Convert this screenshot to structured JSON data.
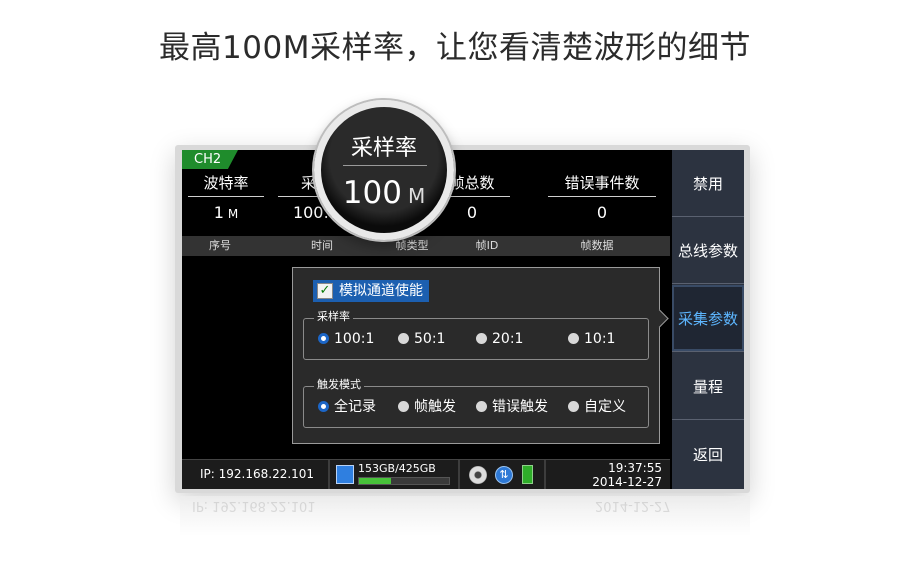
{
  "headline": "最高100M采样率，让您看清楚波形的细节",
  "channel_tag": "CH2",
  "stats": [
    {
      "label": "波特率",
      "value": "1",
      "unit": "M"
    },
    {
      "label": "采样",
      "value": "100:1",
      "unit": ""
    },
    {
      "label": "帧总数",
      "value": "0",
      "unit": ""
    },
    {
      "label": "错误事件数",
      "value": "0",
      "unit": ""
    }
  ],
  "table_headers": [
    "序号",
    "时间",
    "帧类型",
    "帧ID",
    "帧数据"
  ],
  "dialog": {
    "checkbox_label": "模拟通道使能",
    "checkbox_checked": true,
    "sample_group": {
      "title": "采样率",
      "options": [
        "100:1",
        "50:1",
        "20:1",
        "10:1"
      ],
      "selected": "100:1"
    },
    "trigger_group": {
      "title": "触发模式",
      "options": [
        "全记录",
        "帧触发",
        "错误触发",
        "自定义"
      ],
      "selected": "全记录"
    }
  },
  "status_bar": {
    "ip": "IP: 192.168.22.101",
    "disk_usage": "153GB/425GB",
    "disk_fraction": 0.36,
    "time": "19:37:55",
    "date": "2014-12-27"
  },
  "menu": {
    "items": [
      "禁用",
      "总线参数",
      "采集参数",
      "量程",
      "返回"
    ],
    "active": "采集参数"
  },
  "magnifier": {
    "label": "采样率",
    "value": "100",
    "unit": "M"
  },
  "colors": {
    "accent_blue": "#1c66c7",
    "channel_green": "#1f8c2c",
    "menu_active_text": "#5db6ff"
  }
}
